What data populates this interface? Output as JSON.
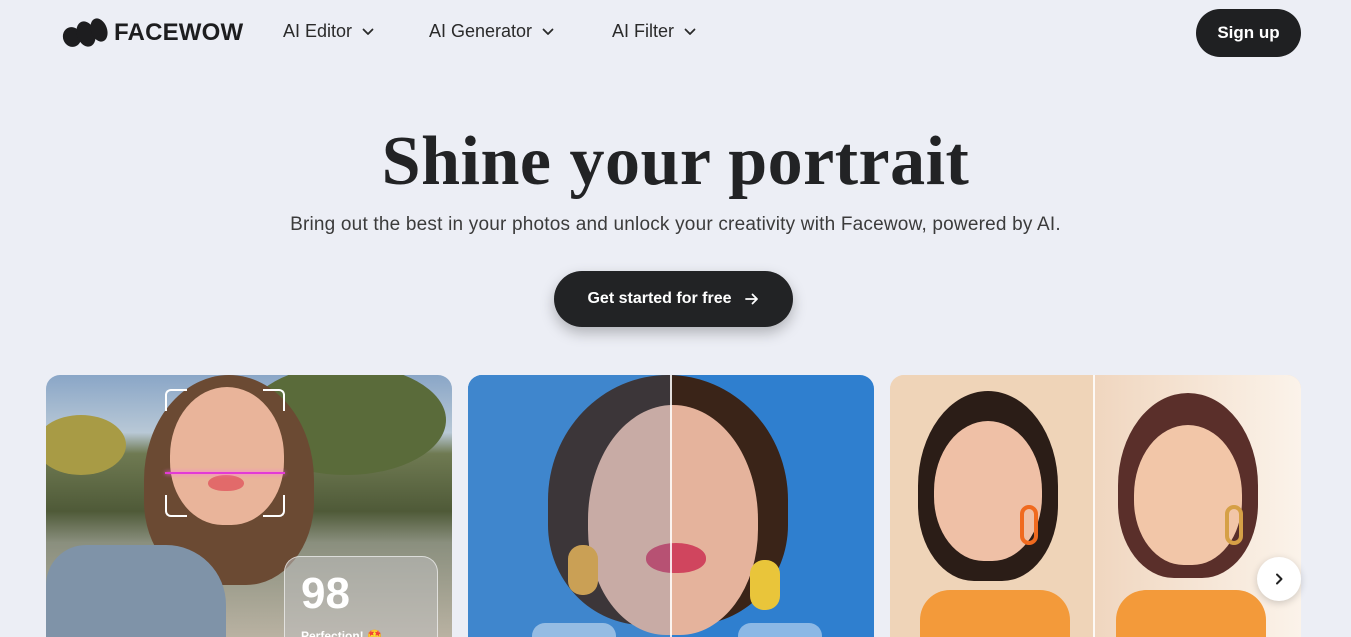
{
  "brand": {
    "name": "FACEWOW"
  },
  "nav": {
    "items": [
      {
        "label": "AI Editor",
        "icon": "chevron-down-icon"
      },
      {
        "label": "AI Generator",
        "icon": "chevron-down-icon"
      },
      {
        "label": "AI Filter",
        "icon": "chevron-down-icon"
      }
    ],
    "signup_label": "Sign up"
  },
  "hero": {
    "title": "Shine your portrait",
    "subtitle": "Bring out the best in your photos and unlock your creativity with Facewow, powered by AI.",
    "cta_label": "Get started for free",
    "cta_icon": "arrow-right-icon"
  },
  "cards": [
    {
      "score": "98",
      "score_label": "Perfection! 🤩"
    },
    {},
    {}
  ],
  "carousel": {
    "next_icon": "chevron-right-icon"
  },
  "colors": {
    "background": "#eceef5",
    "dark_button": "#1f2022",
    "scan_line": "#e23ad6"
  }
}
